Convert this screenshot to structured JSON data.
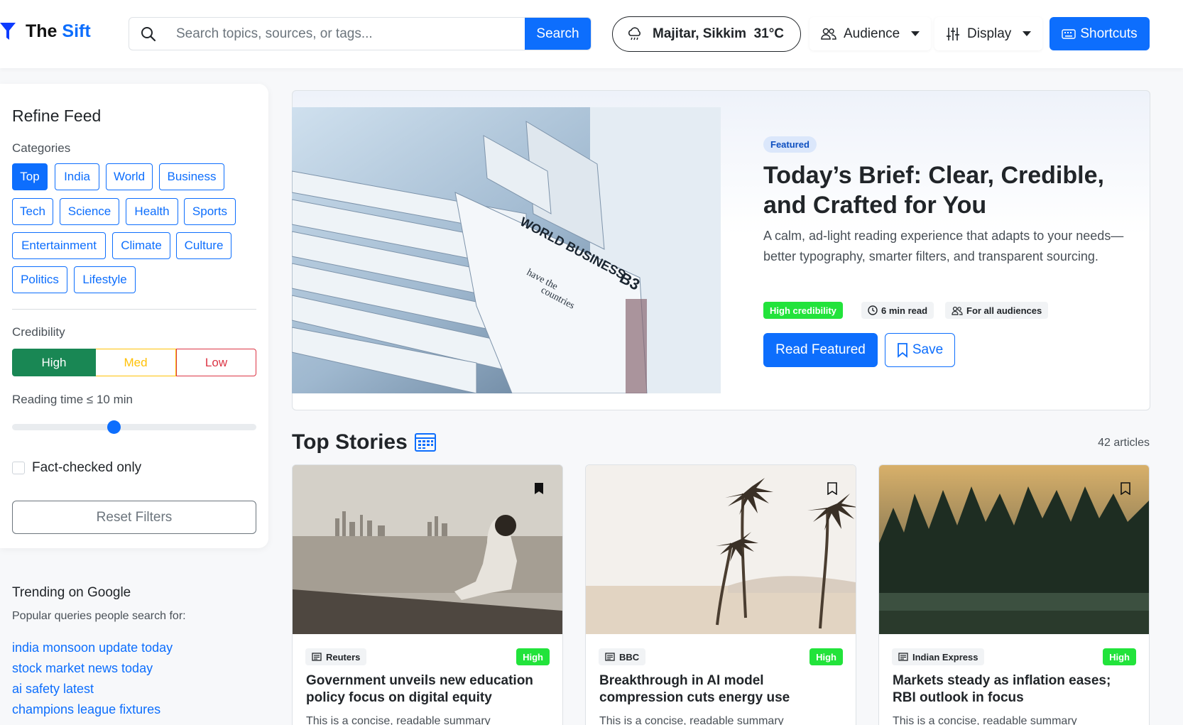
{
  "header": {
    "brand_prefix": "The",
    "brand_accent": "Sift",
    "search_placeholder": "Search topics, sources, or tags...",
    "search_button": "Search",
    "weather": "Majitar, Sikkim  31°C",
    "audience_label": "Audience",
    "display_label": "Display",
    "shortcuts_label": "Shortcuts"
  },
  "sidebar": {
    "title": "Refine Feed",
    "categories_label": "Categories",
    "categories": [
      "Top",
      "India",
      "World",
      "Business",
      "Tech",
      "Science",
      "Health",
      "Sports",
      "Entertainment",
      "Climate",
      "Culture",
      "Politics",
      "Lifestyle"
    ],
    "active_category": "Top",
    "credibility_label": "Credibility",
    "credibility": [
      "High",
      "Med",
      "Low"
    ],
    "reading_time_label": "Reading time ≤ 10 min",
    "reading_time_fraction": 0.42,
    "fact_checked_label": "Fact-checked only",
    "reset_label": "Reset Filters",
    "trending_title": "Trending on Google",
    "trending_sub": "Popular queries people search for:",
    "trending": [
      "india monsoon update today",
      "stock market news today",
      "ai safety latest",
      "champions league fixtures"
    ]
  },
  "featured": {
    "badge": "Featured",
    "title": "Today’s Brief: Clear, Credible, and Crafted for You",
    "description": "A calm, ad-light reading experience that adapts to your needs—better typography, smarter filters, and transparent sourcing.",
    "credibility": "High credibility",
    "read_time": "6 min read",
    "audience": "For all audiences",
    "read_button": "Read Featured",
    "save_button": "Save"
  },
  "top_stories": {
    "title": "Top Stories",
    "count": "42 articles",
    "stories": [
      {
        "source": "Reuters",
        "credibility": "High",
        "title": "Government unveils new education policy focus on digital equity",
        "summary": "This is a concise, readable summary"
      },
      {
        "source": "BBC",
        "credibility": "High",
        "title": "Breakthrough in AI model compression cuts energy use",
        "summary": "This is a concise, readable summary"
      },
      {
        "source": "Indian Express",
        "credibility": "High",
        "title": "Markets steady as inflation eases; RBI outlook in focus",
        "summary": "This is a concise, readable summary"
      }
    ]
  },
  "colors": {
    "primary": "#0d6efd",
    "success": "#198754",
    "warning": "#ffc107",
    "danger": "#dc3545",
    "badge_green": "#22e33b"
  }
}
